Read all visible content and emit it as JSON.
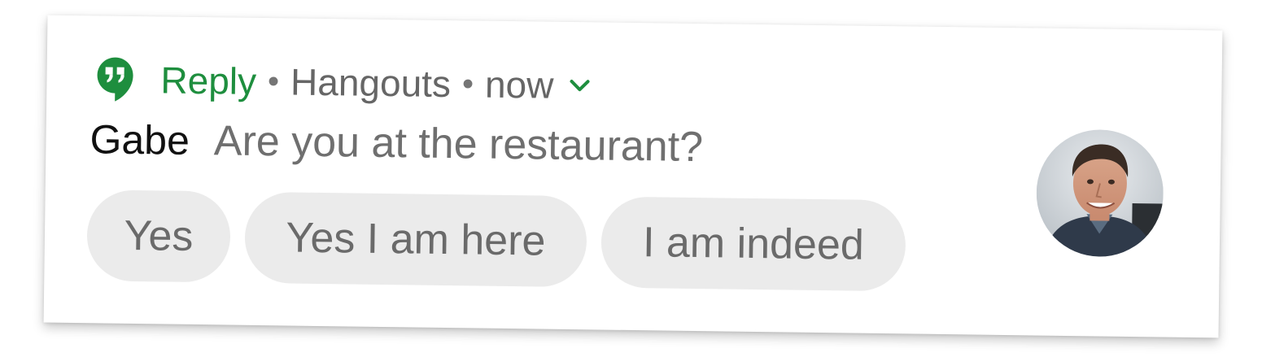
{
  "notification": {
    "app_name": "Reply",
    "separator": "•",
    "source": "Hangouts",
    "time": "now",
    "sender": "Gabe",
    "message": "Are you at the restaurant?",
    "smart_replies": [
      {
        "label": "Yes"
      },
      {
        "label": "Yes I am here"
      },
      {
        "label": "I am indeed"
      }
    ]
  },
  "icons": {
    "app_icon": "hangouts-quote-icon",
    "expand_icon": "chevron-down-icon",
    "avatar": "contact-avatar"
  },
  "colors": {
    "accent": "#1e8e3e",
    "chip_background": "#ebebeb",
    "secondary_text": "#6f6f6f"
  }
}
